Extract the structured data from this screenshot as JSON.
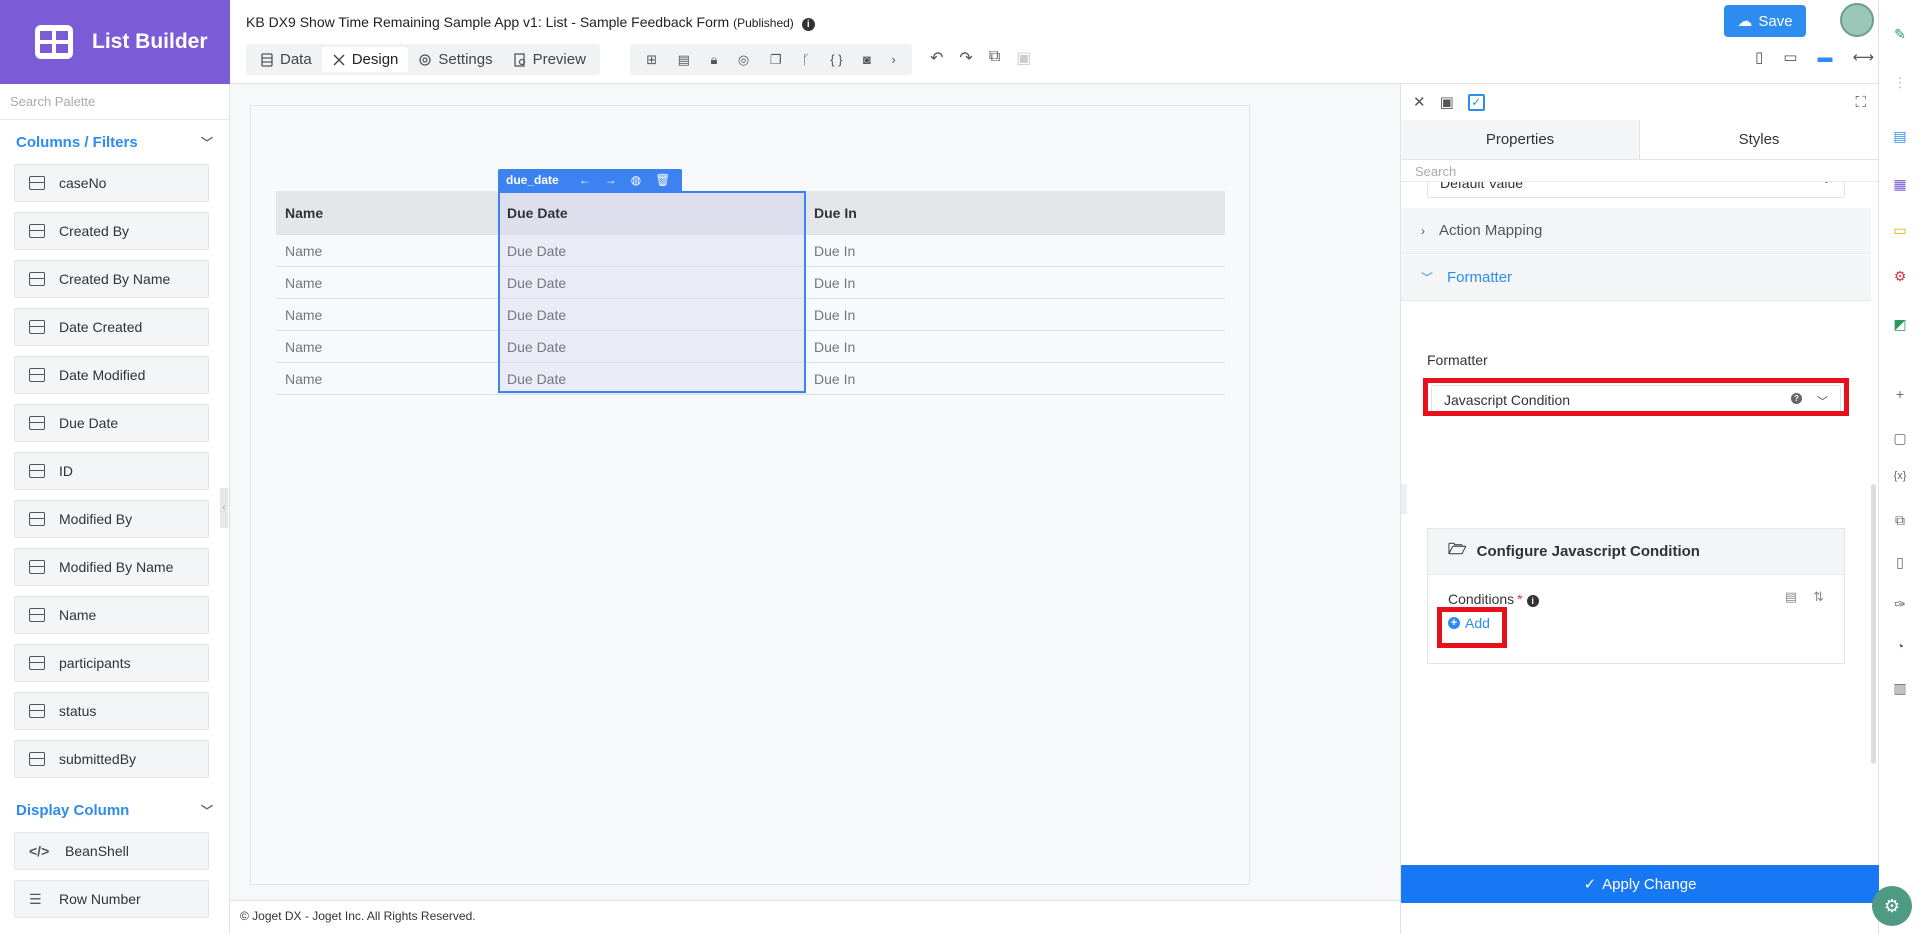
{
  "brand": {
    "title": "List Builder"
  },
  "header": {
    "app_title": "KB DX9 Show Time Remaining Sample App v1: List - Sample Feedback Form",
    "status": "(Published)",
    "save_label": "Save",
    "tabs": [
      {
        "label": "Data",
        "icon": "database-icon"
      },
      {
        "label": "Design",
        "icon": "design-tools-icon"
      },
      {
        "label": "Settings",
        "icon": "gear-icon"
      },
      {
        "label": "Preview",
        "icon": "preview-icon"
      }
    ]
  },
  "palette": {
    "search_placeholder": "Search Palette",
    "sections": [
      {
        "title": "Columns / Filters",
        "items": [
          "caseNo",
          "Created By",
          "Created By Name",
          "Date Created",
          "Date Modified",
          "Due Date",
          "ID",
          "Modified By",
          "Modified By Name",
          "Name",
          "participants",
          "status",
          "submittedBy"
        ]
      },
      {
        "title": "Display Column",
        "items": [
          "BeanShell",
          "Row Number"
        ]
      }
    ]
  },
  "canvas": {
    "selected_column_id": "due_date",
    "columns": [
      "Name",
      "Due Date",
      "Due In"
    ],
    "rows": [
      [
        "Name",
        "Due Date",
        "Due In"
      ],
      [
        "Name",
        "Due Date",
        "Due In"
      ],
      [
        "Name",
        "Due Date",
        "Due In"
      ],
      [
        "Name",
        "Due Date",
        "Due In"
      ],
      [
        "Name",
        "Due Date",
        "Due In"
      ]
    ]
  },
  "footer": {
    "text": "© Joget DX - Joget Inc. All Rights Reserved."
  },
  "properties": {
    "tabs": [
      "Properties",
      "Styles"
    ],
    "search_placeholder": "Search",
    "default_value_select": "Default Value",
    "action_mapping": "Action Mapping",
    "formatter_section": "Formatter",
    "formatter_label": "Formatter",
    "formatter_value": "Javascript Condition",
    "config_title": "Configure Javascript Condition",
    "conditions_label": "Conditions",
    "required_mark": "*",
    "add_label": "Add",
    "apply_label": "Apply Change"
  },
  "colors": {
    "brand": "#7b5cd6",
    "accent": "#2d8cf0",
    "apply": "#1877f2",
    "highlight": "#e8101a"
  }
}
